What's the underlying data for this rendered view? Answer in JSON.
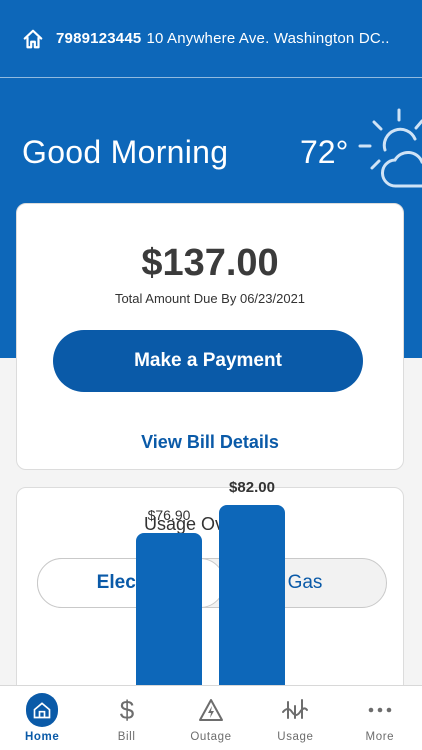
{
  "account": {
    "number": "7989123445",
    "address": "10 Anywhere Ave. Washington DC.."
  },
  "greeting": "Good Morning",
  "weather": {
    "temperature": "72°",
    "icon": "partly-cloudy-icon"
  },
  "bill": {
    "amount": "$137.00",
    "due_text": "Total Amount Due By 06/23/2021",
    "pay_button": "Make a Payment",
    "details_link": "View Bill Details"
  },
  "usage": {
    "title": "Usage Overview",
    "toggle": {
      "active": "Electric",
      "inactive": "Gas"
    },
    "bars": [
      {
        "label": "$76.90",
        "value": 76.9
      },
      {
        "label": "$82.00",
        "value": 82.0
      }
    ]
  },
  "tabs": [
    {
      "label": "Home",
      "icon": "home-icon",
      "active": true
    },
    {
      "label": "Bill",
      "icon": "dollar-icon",
      "active": false
    },
    {
      "label": "Outage",
      "icon": "outage-warning-icon",
      "active": false
    },
    {
      "label": "Usage",
      "icon": "usage-meter-icon",
      "active": false
    },
    {
      "label": "More",
      "icon": "more-dots-icon",
      "active": false
    }
  ],
  "colors": {
    "brand": "#0d67b9",
    "accent": "#0a5aa8",
    "text": "#3b3b3b"
  }
}
